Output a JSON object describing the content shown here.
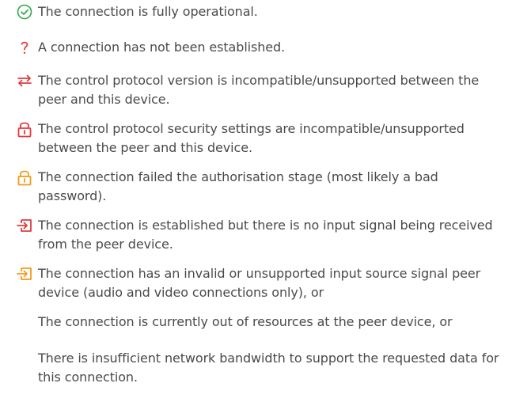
{
  "colors": {
    "text": "#4a4a4a",
    "ok_green": "#2fa84f",
    "error_red": "#e23a3a",
    "warn_orange": "#f59a1b"
  },
  "statuses": [
    {
      "icon": "check-circle-icon",
      "color": "#2fa84f",
      "text": "The connection is fully operational."
    },
    {
      "icon": "question-mark-icon",
      "color": "#e23a3a",
      "text": "A connection has not been established."
    },
    {
      "icon": "swap-arrows-icon",
      "color": "#e23a3a",
      "text": "The control protocol version is incompatible/unsupported between the peer and this device."
    },
    {
      "icon": "padlock-icon",
      "color": "#e23a3a",
      "text": "The control protocol security settings are incompatible/unsupported between the peer and this device."
    },
    {
      "icon": "padlock-icon",
      "color": "#f59a1b",
      "text": "The connection failed the authorisation stage (most likely a bad password)."
    },
    {
      "icon": "input-signal-icon",
      "color": "#e23a3a",
      "text": "The connection is established but there is no input signal being received from the peer device."
    },
    {
      "icon": "input-signal-icon",
      "color": "#f59a1b",
      "text": "The connection has an invalid or unsupported input source signal peer device (audio and video connections only), or"
    }
  ],
  "continuations": [
    "The connection is currently out of resources at the peer device, or",
    "There is insufficient network bandwidth to support the requested data for this connection."
  ]
}
